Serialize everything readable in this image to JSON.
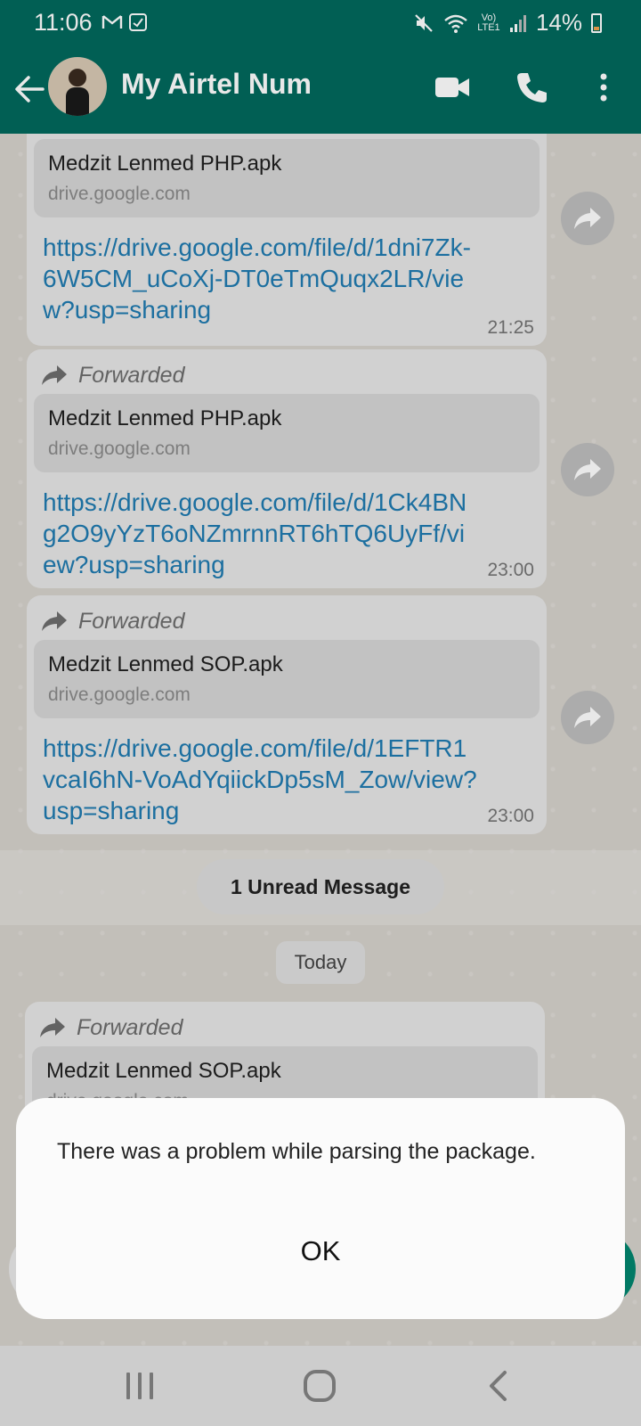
{
  "status_bar": {
    "time": "11:06",
    "network_label": "Vo) LTE1",
    "battery": "14%",
    "icons": [
      "gmail-icon",
      "message-check-icon",
      "mute-icon",
      "wifi-icon",
      "signal-icon",
      "battery-icon"
    ]
  },
  "app_bar": {
    "title": "My Airtel Num",
    "icons": [
      "back-arrow-icon",
      "video-call-icon",
      "phone-icon",
      "more-vert-icon"
    ]
  },
  "messages": [
    {
      "forwarded": false,
      "preview_title": "Medzit Lenmed PHP.apk",
      "preview_host": "drive.google.com",
      "link": "https://drive.google.com/file/d/1dni7Zk-6W5CM_uCoXj-DT0eTmQuqx2LR/view?usp=sharing",
      "time": "21:25"
    },
    {
      "forwarded": true,
      "forwarded_label": "Forwarded",
      "preview_title": "Medzit Lenmed PHP.apk",
      "preview_host": "drive.google.com",
      "link": "https://drive.google.com/file/d/1Ck4BNg2O9yYzT6oNZmrnnRT6hTQ6UyFf/view?usp=sharing",
      "time": "23:00"
    },
    {
      "forwarded": true,
      "forwarded_label": "Forwarded",
      "preview_title": "Medzit Lenmed SOP.apk",
      "preview_host": "drive.google.com",
      "link": "https://drive.google.com/file/d/1EFTR1vcaI6hN-VoAdYqiickDp5sM_Zow/view?usp=sharing",
      "time": "23:00"
    },
    {
      "forwarded": true,
      "forwarded_label": "Forwarded",
      "preview_title": "Medzit Lenmed SOP.apk",
      "preview_host": "drive.google.com"
    }
  ],
  "unread_label": "1 Unread Message",
  "date_label": "Today",
  "dialog": {
    "message": "There was a problem while parsing the package.",
    "ok_label": "OK"
  },
  "colors": {
    "header": "#02695d",
    "link": "#1f7bb0",
    "bubble": "#e6e6e6"
  }
}
